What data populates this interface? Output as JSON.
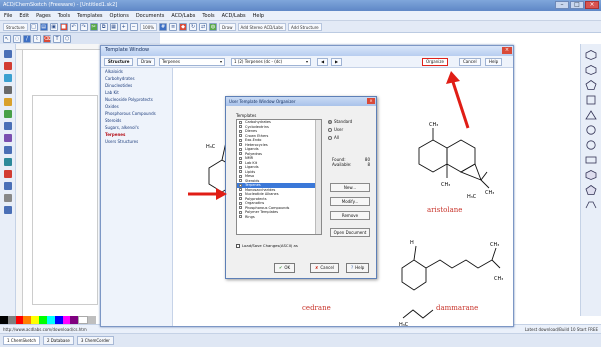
{
  "app": {
    "title": "ACD/ChemSketch (Freeware) - [Untitled1.sk2]",
    "window_caps": [
      "–",
      "□",
      "×"
    ]
  },
  "menu": [
    "File",
    "Edit",
    "Pages",
    "Tools",
    "Templates",
    "Options",
    "Documents",
    "ACD/Labs",
    "Tools",
    "ACD/Labs",
    "Help"
  ],
  "toolbar": {
    "mode_label": "Structure",
    "zoom": "100%",
    "extra": [
      "Draw",
      "Add Stereo ACD/Labs",
      "Add Structure"
    ]
  },
  "template_window": {
    "title": "Template Window",
    "structure_btn": "Structure",
    "draw_btn": "Draw",
    "category_select": "Terpenes",
    "page_select": "1 (2) Terpenes (dc - (dc)",
    "organize_btn": "Organize",
    "cancel_btn": "Cancel",
    "help_btn": "Help",
    "categories": [
      "Alkaloids",
      "Carbohydrates",
      "Dinucleotides",
      "Lab Kit",
      "Nucleoside Polyprotects",
      "Oxides",
      "Phosphorous Compounds",
      "Steroids",
      "Sugars, alkenol's",
      "Terpenes",
      "Users Structures"
    ],
    "selected_category": "Terpenes",
    "molecule_labels": {
      "aristolane": "aristolane",
      "cedrane": "cedrane",
      "dammarane": "dammarane"
    },
    "atom_labels": [
      "CH3",
      "CH3",
      "H3C",
      "H3C",
      "CH3",
      "CH3",
      "H",
      "CH3"
    ]
  },
  "organizer": {
    "title": "User Template Window Organizer",
    "list_label": "Templates",
    "templates": [
      {
        "name": "Carbohydrates",
        "checked": true
      },
      {
        "name": "Cyclodextrins",
        "checked": false
      },
      {
        "name": "Dienes",
        "checked": false
      },
      {
        "name": "Crown Ethers",
        "checked": false
      },
      {
        "name": "Exo-Endo",
        "checked": false
      },
      {
        "name": "Heterocycles",
        "checked": true
      },
      {
        "name": "Ligands",
        "checked": false
      },
      {
        "name": "Polyedras",
        "checked": false
      },
      {
        "name": "NMR",
        "checked": false
      },
      {
        "name": "Lab Kit",
        "checked": true
      },
      {
        "name": "Ligands",
        "checked": false
      },
      {
        "name": "Lipids",
        "checked": true
      },
      {
        "name": "Meso",
        "checked": false
      },
      {
        "name": "Steroids",
        "checked": true
      },
      {
        "name": "Terpenes",
        "checked": true
      },
      {
        "name": "Monosaccharides",
        "checked": false
      },
      {
        "name": "Nucleotide Alkanes",
        "checked": false
      },
      {
        "name": "Polyprotects",
        "checked": false
      },
      {
        "name": "Organotins",
        "checked": false
      },
      {
        "name": "Phosphorous Compounds",
        "checked": false
      },
      {
        "name": "Polymer Templates",
        "checked": true
      },
      {
        "name": "Rings",
        "checked": true
      }
    ],
    "highlighted_index": 14,
    "radio": [
      {
        "label": "Standard",
        "selected": true
      },
      {
        "label": "User",
        "selected": false
      },
      {
        "label": "All",
        "selected": false
      }
    ],
    "found_label": "Found:",
    "found_value": "80",
    "available_label": "Available:",
    "available_value": "8",
    "buttons": [
      "New...",
      "Modify...",
      "Remove",
      "Open Document"
    ],
    "checkbox_label": "Load/Save Changes(ASCII) as",
    "ok": "OK",
    "cancel": "Cancel",
    "help": "Help"
  },
  "status": {
    "left": "http://www.acdlabs.com/download/cs.htm",
    "right": "Latest download/Build 10  Start FREE"
  },
  "bottom_tabs": [
    "1 ChemSketch",
    "2 Database",
    "3 ChemCorder"
  ],
  "bottom_misc": [
    "Dims",
    "Scale: Page",
    "500x500"
  ],
  "colors": {
    "palette": [
      "#000000",
      "#7f7f7f",
      "#ff0000",
      "#ff7f00",
      "#ffff00",
      "#00ff00",
      "#00ffff",
      "#0000ff",
      "#ff00ff",
      "#7f007f",
      "#ffffff",
      "#bfbfbf"
    ],
    "arrow": "#e01d15",
    "accent": "#3b78d8"
  }
}
